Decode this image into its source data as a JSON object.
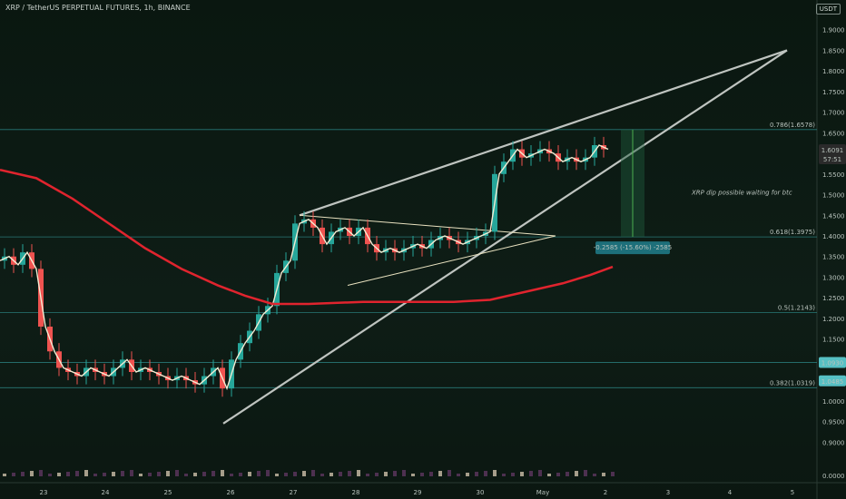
{
  "header": {
    "title": "XRP / TetherUS PERPETUAL FUTURES, 1h, BINANCE",
    "currency": "USDT"
  },
  "chart_data": {
    "type": "candlestick",
    "y_ticks": [
      "1.9000",
      "1.8500",
      "1.8000",
      "1.7500",
      "1.7000",
      "1.6500",
      "1.6000",
      "1.5500",
      "1.5000",
      "1.4500",
      "1.4000",
      "1.3500",
      "1.3000",
      "1.2500",
      "1.2000",
      "1.1500",
      "1.1000",
      "1.0500",
      "1.0000",
      "0.9500",
      "0.9000",
      "0.0000"
    ],
    "x_ticks": [
      "23",
      "24",
      "25",
      "26",
      "27",
      "28",
      "29",
      "30",
      "May",
      "2",
      "3",
      "4",
      "5"
    ],
    "price_badges": [
      {
        "label": "1.6091",
        "sub": "57:51",
        "y": 1.6091,
        "bg": "#2a2a2a",
        "fg": "#ffffff"
      },
      {
        "label": "1.0930",
        "y": 1.093,
        "bg": "#56c0c4",
        "fg": "#0b1a14"
      },
      {
        "label": "1.0485",
        "y": 1.0485,
        "bg": "#56c0c4",
        "fg": "#0b1a14"
      }
    ],
    "fib_levels": [
      {
        "label": "0.786(1.6578)",
        "y": 1.6578
      },
      {
        "label": "0.618(1.3975)",
        "y": 1.3975
      },
      {
        "label": "0.5(1.2143)",
        "y": 1.2143
      },
      {
        "label": "0.382(1.0319)",
        "y": 1.0319
      }
    ],
    "extra_hlines": [
      1.093
    ],
    "annotation_text": "XRP dip possible waiting for btc",
    "measure_label": "-0.2585 (-15.60%) -2585",
    "ma200_series": [
      [
        0,
        1.56
      ],
      [
        40,
        1.54
      ],
      [
        80,
        1.49
      ],
      [
        120,
        1.43
      ],
      [
        160,
        1.37
      ],
      [
        200,
        1.32
      ],
      [
        240,
        1.28
      ],
      [
        270,
        1.255
      ],
      [
        300,
        1.235
      ],
      [
        340,
        1.235
      ],
      [
        400,
        1.24
      ],
      [
        450,
        1.24
      ],
      [
        500,
        1.24
      ],
      [
        540,
        1.245
      ],
      [
        580,
        1.265
      ],
      [
        620,
        1.285
      ],
      [
        650,
        1.305
      ],
      [
        675,
        1.325
      ]
    ],
    "price_series": [
      [
        0,
        1.34
      ],
      [
        10,
        1.35
      ],
      [
        20,
        1.33
      ],
      [
        30,
        1.36
      ],
      [
        40,
        1.32
      ],
      [
        50,
        1.18
      ],
      [
        60,
        1.12
      ],
      [
        70,
        1.08
      ],
      [
        80,
        1.07
      ],
      [
        90,
        1.06
      ],
      [
        100,
        1.08
      ],
      [
        110,
        1.07
      ],
      [
        120,
        1.06
      ],
      [
        130,
        1.08
      ],
      [
        140,
        1.1
      ],
      [
        150,
        1.07
      ],
      [
        160,
        1.08
      ],
      [
        170,
        1.07
      ],
      [
        180,
        1.06
      ],
      [
        190,
        1.05
      ],
      [
        200,
        1.06
      ],
      [
        210,
        1.05
      ],
      [
        220,
        1.04
      ],
      [
        230,
        1.06
      ],
      [
        240,
        1.08
      ],
      [
        250,
        1.03
      ],
      [
        260,
        1.1
      ],
      [
        270,
        1.14
      ],
      [
        280,
        1.17
      ],
      [
        290,
        1.21
      ],
      [
        300,
        1.23
      ],
      [
        310,
        1.31
      ],
      [
        320,
        1.34
      ],
      [
        330,
        1.43
      ],
      [
        340,
        1.44
      ],
      [
        350,
        1.42
      ],
      [
        360,
        1.38
      ],
      [
        370,
        1.41
      ],
      [
        380,
        1.42
      ],
      [
        390,
        1.4
      ],
      [
        400,
        1.42
      ],
      [
        410,
        1.38
      ],
      [
        420,
        1.36
      ],
      [
        430,
        1.37
      ],
      [
        440,
        1.36
      ],
      [
        450,
        1.37
      ],
      [
        460,
        1.38
      ],
      [
        470,
        1.37
      ],
      [
        480,
        1.39
      ],
      [
        490,
        1.4
      ],
      [
        500,
        1.39
      ],
      [
        510,
        1.38
      ],
      [
        520,
        1.39
      ],
      [
        530,
        1.4
      ],
      [
        540,
        1.41
      ],
      [
        550,
        1.55
      ],
      [
        560,
        1.58
      ],
      [
        570,
        1.61
      ],
      [
        580,
        1.59
      ],
      [
        590,
        1.6
      ],
      [
        600,
        1.61
      ],
      [
        610,
        1.6
      ],
      [
        620,
        1.58
      ],
      [
        630,
        1.59
      ],
      [
        640,
        1.58
      ],
      [
        650,
        1.59
      ],
      [
        660,
        1.62
      ],
      [
        670,
        1.61
      ]
    ]
  }
}
